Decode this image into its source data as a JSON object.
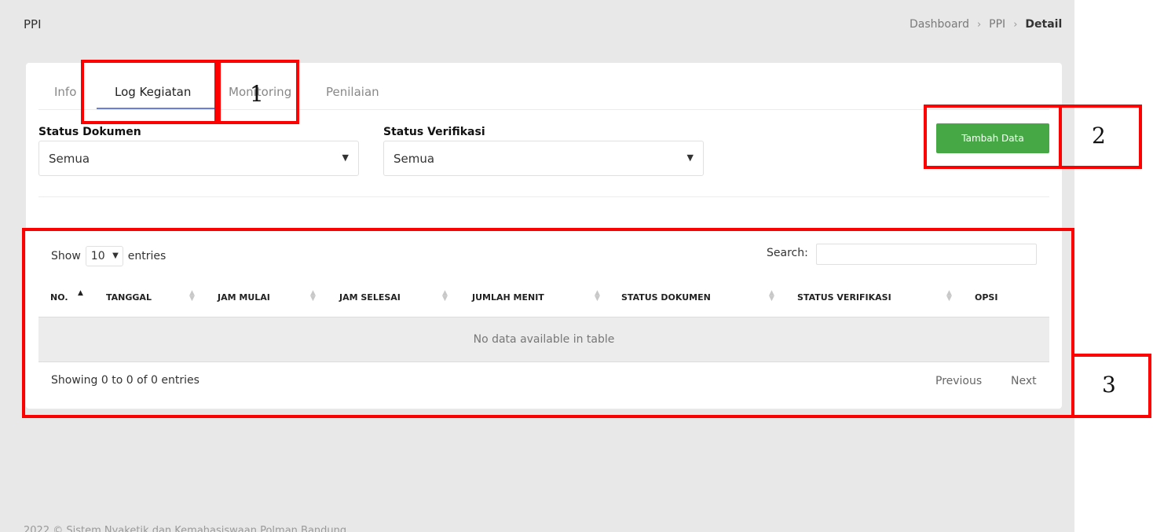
{
  "header": {
    "title": "PPI",
    "breadcrumb": [
      "Dashboard",
      "PPI",
      "Detail"
    ]
  },
  "tabs": [
    {
      "label": "Info",
      "active": false
    },
    {
      "label": "Log Kegiatan",
      "active": true
    },
    {
      "label": "Monitoring",
      "active": false
    },
    {
      "label": "Penilaian",
      "active": false
    }
  ],
  "filters": {
    "status_dokumen": {
      "label": "Status Dokumen",
      "value": "Semua"
    },
    "status_verifikasi": {
      "label": "Status Verifikasi",
      "value": "Semua"
    }
  },
  "add_button_label": "Tambah Data",
  "datatable": {
    "show_label": "Show",
    "length_value": "10",
    "entries_label": "entries",
    "search_label": "Search:",
    "search_value": "",
    "columns": [
      "NO.",
      "TANGGAL",
      "JAM MULAI",
      "JAM SELESAI",
      "JUMLAH MENIT",
      "STATUS DOKUMEN",
      "STATUS VERIFIKASI",
      "OPSI"
    ],
    "empty_message": "No data available in table",
    "info": "Showing 0 to 0 of 0 entries",
    "previous_label": "Previous",
    "next_label": "Next"
  },
  "footer": {
    "text": "2022 © Sistem Nyaketik dan Kemahasiswaan Polman Bandung"
  },
  "annotations": [
    {
      "label": "1"
    },
    {
      "label": "2"
    },
    {
      "label": "3"
    }
  ],
  "colors": {
    "accent_green": "#45a844",
    "tab_underline": "#6b7fd7",
    "annotation_red": "#ff0000"
  }
}
